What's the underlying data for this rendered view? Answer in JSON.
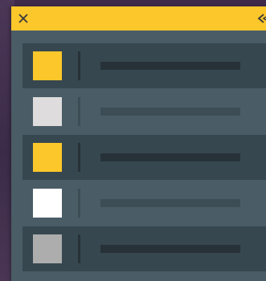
{
  "colors": {
    "header": "#fcc72b",
    "panel": "#4a5c66",
    "row_dark": "#37474f",
    "bar_dark": "#263238",
    "bar_light": "#3c4d56"
  },
  "header": {
    "close_icon": "close-icon",
    "back_icon": "chevron-left-icon"
  },
  "rows": [
    {
      "style": "dark",
      "swatch_color": "#fcc72b"
    },
    {
      "style": "light",
      "swatch_color": "#dedcdc"
    },
    {
      "style": "dark",
      "swatch_color": "#fcc72b"
    },
    {
      "style": "light",
      "swatch_color": "#ffffff"
    },
    {
      "style": "dark",
      "swatch_color": "#adadad"
    }
  ]
}
